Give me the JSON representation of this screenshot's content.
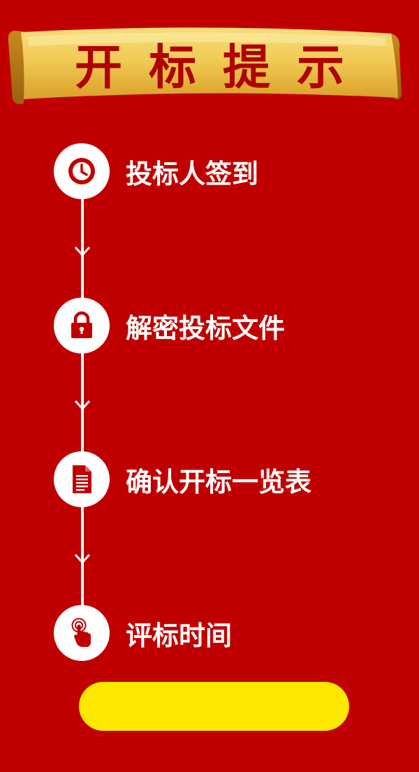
{
  "header": {
    "title": "开标提示"
  },
  "steps": [
    {
      "label": "投标人签到",
      "icon": "clock-icon"
    },
    {
      "label": "解密投标文件",
      "icon": "lock-icon"
    },
    {
      "label": "确认开标一览表",
      "icon": "document-icon"
    },
    {
      "label": "评标时间",
      "icon": "touch-icon"
    }
  ],
  "action_button": {
    "label": ""
  },
  "colors": {
    "background": "#c00000",
    "banner_gold": "#f0c34a",
    "title_red": "#b00000",
    "button_yellow": "#ffe800",
    "icon_red": "#c00000"
  }
}
